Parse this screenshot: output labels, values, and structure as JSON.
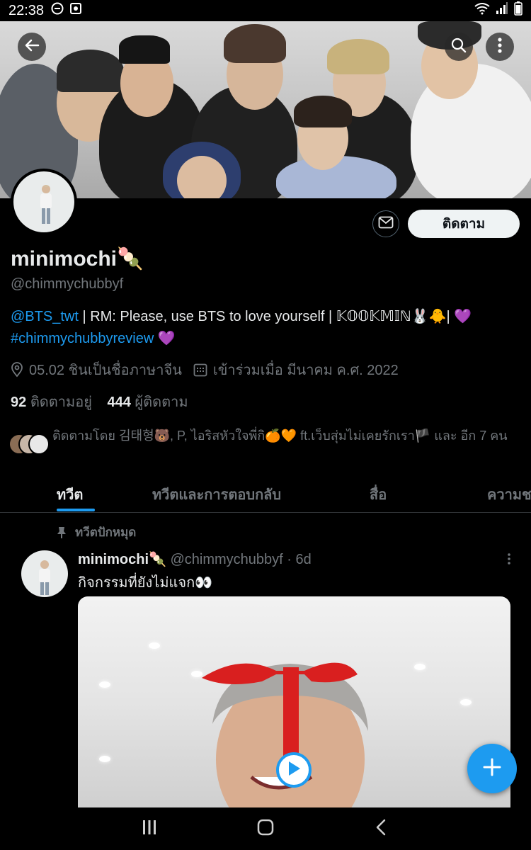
{
  "status_bar": {
    "time": "22:38",
    "icons": [
      "do-not-disturb-icon",
      "screenshot-icon",
      "wifi-icon",
      "signal-icon",
      "battery-icon"
    ]
  },
  "header": {
    "back_icon": "back-arrow-icon",
    "search_icon": "search-icon",
    "more_icon": "more-vertical-icon"
  },
  "profile": {
    "name": "minimochi",
    "name_emoji": "🍡",
    "handle": "@chimmychubbyf",
    "message_icon": "envelope-icon",
    "follow_label": "ติดตาม",
    "bio": {
      "mention": "@BTS_twt",
      "text1": " | RM: Please, use BTS to love yourself | 𝕂𝕆𝕆𝕂𝕄𝕀ℕ🐰🐥| 💜",
      "hashtag": "#chimmychubbyreview",
      "text2": " 💜"
    },
    "location": "05.02 ชินเป็นชื่อภาษาจีน",
    "joined": "เข้าร่วมเมื่อ มีนาคม ค.ศ. 2022",
    "following_count": "92",
    "following_label": "ติดตามอยู่",
    "followers_count": "444",
    "followers_label": "ผู้ติดตาม",
    "followed_by": "ติดตามโดย 김태형🐻, P, ไอริสหัวใจพี่กิ🍊🧡 ft.เว็บสุ่มไม่เคยรักเรา🏴 และ อีก 7 คน"
  },
  "tabs": [
    {
      "label": "ทวีต",
      "active": true
    },
    {
      "label": "ทวีตและการตอบกลับ",
      "active": false
    },
    {
      "label": "สื่อ",
      "active": false
    },
    {
      "label": "ความชอบ",
      "active": false
    }
  ],
  "pinned_label": "ทวีตปักหมุด",
  "tweet": {
    "name": "minimochi🍡",
    "meta": "@chimmychubbyf · 6d",
    "text": "กิจกรรมที่ยังไม่แจก👀"
  },
  "colors": {
    "accent": "#1d9bf0",
    "background": "#000000",
    "secondary_text": "#71767b"
  }
}
